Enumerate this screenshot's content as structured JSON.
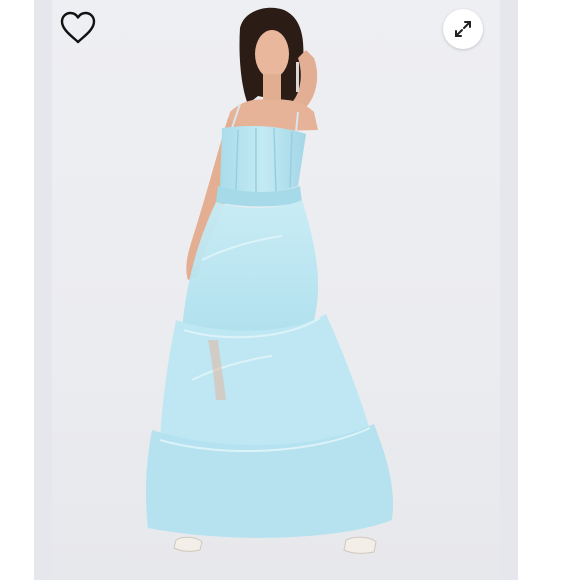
{
  "viewer": {
    "favorite_icon": "heart-outline-icon",
    "expand_icon": "expand-arrows-icon"
  },
  "photo": {
    "subject": "blue-tulle-gown",
    "dress_color": "#b9e6f2",
    "background_color": "#ecedf1"
  }
}
